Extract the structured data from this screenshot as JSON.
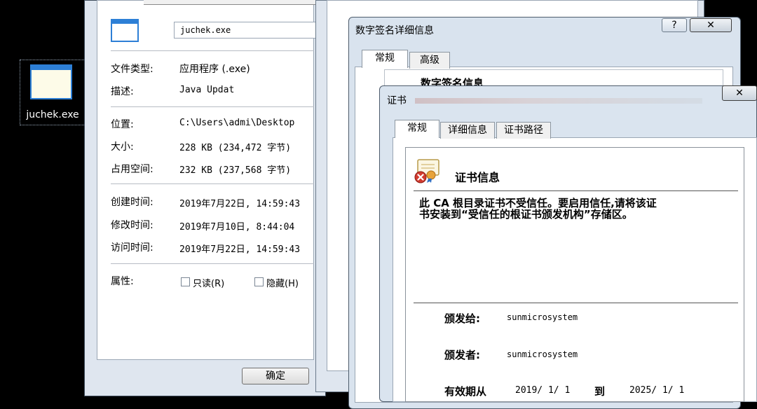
{
  "desktop": {
    "icon_label": "juchek.exe"
  },
  "properties": {
    "file_name": "juchek.exe",
    "rows": [
      {
        "label": "文件类型:",
        "value": "应用程序 (.exe)"
      },
      {
        "label": "描述:",
        "value": "Java Updat"
      },
      {
        "label": "位置:",
        "value": "C:\\Users\\admi\\Desktop"
      },
      {
        "label": "大小:",
        "value": "228 KB (234,472 字节)"
      },
      {
        "label": "占用空间:",
        "value": "232 KB (237,568 字节)"
      },
      {
        "label": "创建时间:",
        "value": "2019年7月22日, 14:59:43"
      },
      {
        "label": "修改时间:",
        "value": "2019年7月10日, 8:44:04"
      },
      {
        "label": "访问时间:",
        "value": "2019年7月22日, 14:59:43"
      }
    ],
    "attributes_label": "属性:",
    "readonly_label": "只读(R)",
    "hidden_label": "隐藏(H)",
    "ok_label": "确定"
  },
  "signature_dialog": {
    "title": "数字签名详细信息",
    "help_glyph": "?",
    "close_glyph": "✕",
    "tabs": [
      "常规",
      "高级"
    ],
    "section_title": "数字签名信息"
  },
  "certificate_dialog": {
    "title": "证书",
    "close_glyph": "✕",
    "tabs": [
      "常规",
      "详细信息",
      "证书路径"
    ],
    "header": "证书信息",
    "warning_line1": "此 CA 根目录证书不受信任。要启用信任,请将该证",
    "warning_line2": "书安装到“受信任的根证书颁发机构”存储区。",
    "issued_to_label": "颁发给:",
    "issued_to_value": "sunmicrosystem",
    "issued_by_label": "颁发者:",
    "issued_by_value": "sunmicrosystem",
    "valid_from_label": "有效期从",
    "valid_from_value": "2019/ 1/ 1",
    "valid_to_label": "到",
    "valid_to_value": "2025/ 1/ 1"
  }
}
